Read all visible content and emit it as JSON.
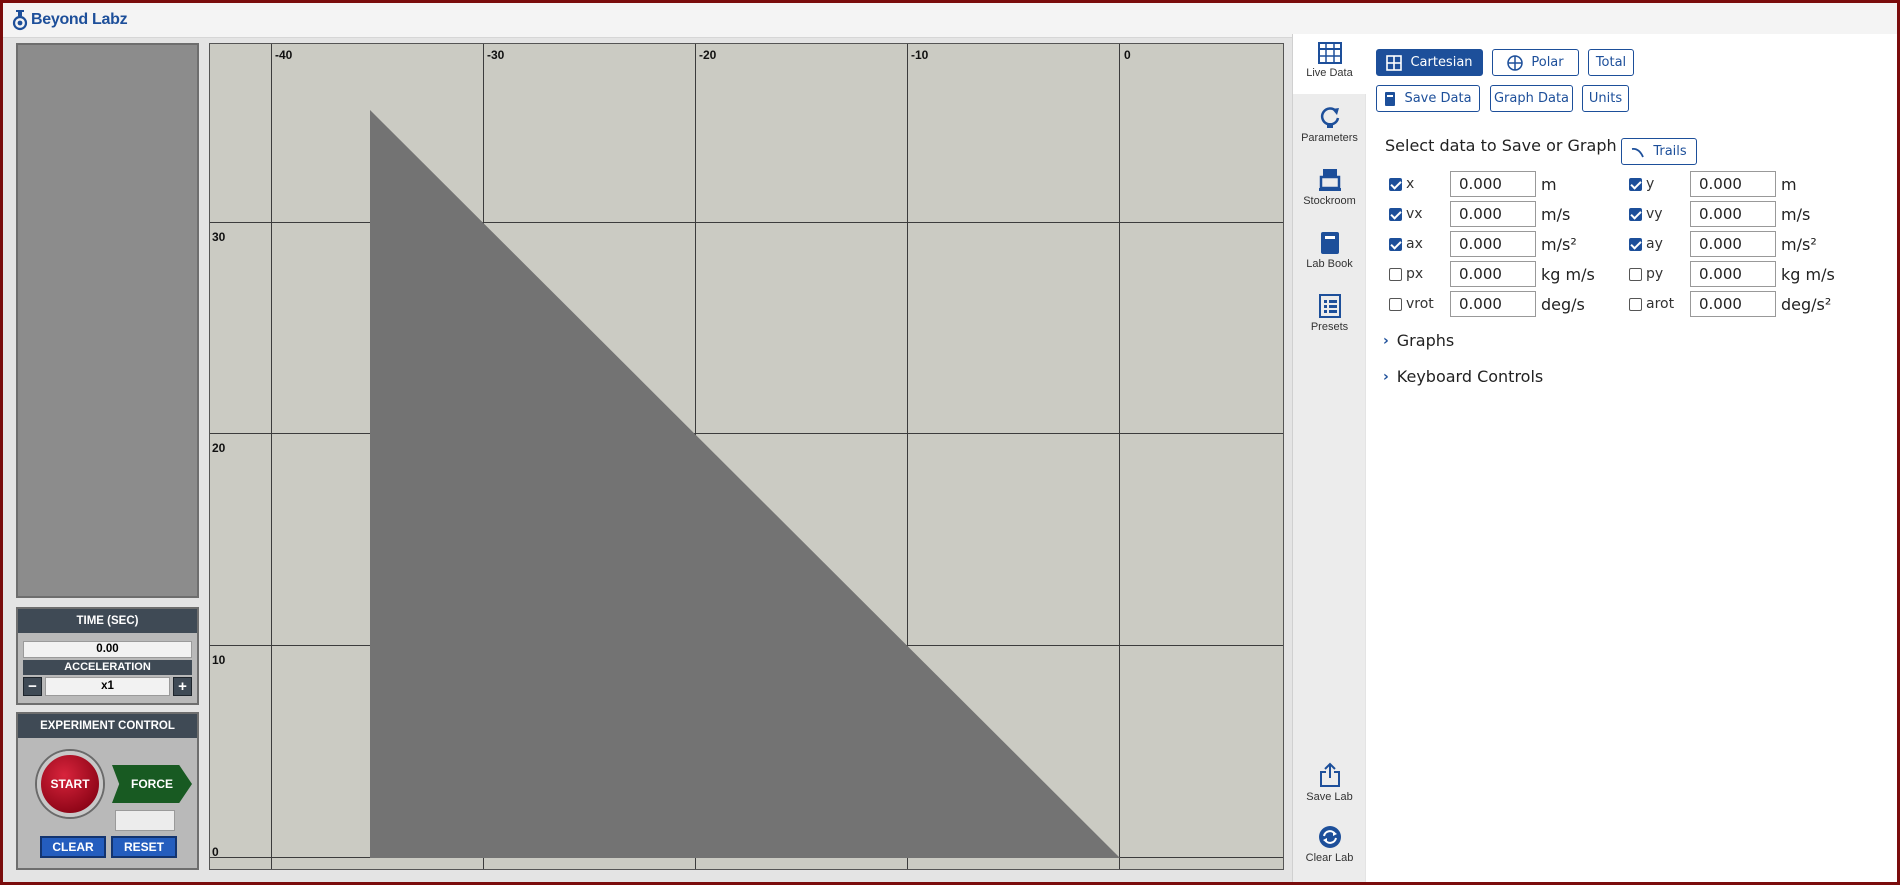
{
  "app": {
    "name": "Beyond Labz",
    "brand_color": "#1d4f9a"
  },
  "left": {
    "time_title": "TIME (SEC)",
    "time_value": "0.00",
    "accel_title": "ACCELERATION",
    "accel_value": "x1",
    "minus": "−",
    "plus": "+",
    "exp_title": "EXPERIMENT CONTROL",
    "start": "START",
    "force": "FORCE",
    "clear": "CLEAR",
    "reset": "RESET"
  },
  "graph": {
    "x_labels": [
      "-40",
      "-30",
      "-20",
      "-10",
      "0"
    ],
    "y_labels": [
      "30",
      "20",
      "10",
      "0"
    ],
    "shape_color": "#737373"
  },
  "tabs": [
    {
      "label": "Live Data",
      "icon": "table-icon"
    },
    {
      "label": "Parameters",
      "icon": "parameters-icon"
    },
    {
      "label": "Stockroom",
      "icon": "stockroom-icon"
    },
    {
      "label": "Lab Book",
      "icon": "lab-book-icon"
    },
    {
      "label": "Presets",
      "icon": "presets-icon"
    },
    {
      "label": "Save Lab",
      "icon": "share-icon"
    },
    {
      "label": "Clear Lab",
      "icon": "refresh-icon"
    }
  ],
  "panel": {
    "modes": {
      "cartesian": "Cartesian",
      "polar": "Polar",
      "total": "Total"
    },
    "actions": {
      "save_data": "Save Data",
      "graph_data": "Graph Data",
      "units": "Units"
    },
    "select_label": "Select data to Save or Graph",
    "trails": "Trails",
    "rows": [
      {
        "label": "x",
        "value": "0.000",
        "unit": "m",
        "checked": true,
        "label2": "y",
        "value2": "0.000",
        "unit2": "m",
        "checked2": true
      },
      {
        "label": "vx",
        "value": "0.000",
        "unit": "m/s",
        "checked": true,
        "label2": "vy",
        "value2": "0.000",
        "unit2": "m/s",
        "checked2": true
      },
      {
        "label": "ax",
        "value": "0.000",
        "unit": "m/s²",
        "checked": true,
        "label2": "ay",
        "value2": "0.000",
        "unit2": "m/s²",
        "checked2": true
      },
      {
        "label": "px",
        "value": "0.000",
        "unit": "kg m/s",
        "checked": false,
        "label2": "py",
        "value2": "0.000",
        "unit2": "kg m/s",
        "checked2": false
      },
      {
        "label": "vrot",
        "value": "0.000",
        "unit": "deg/s",
        "checked": false,
        "label2": "arot",
        "value2": "0.000",
        "unit2": "deg/s²",
        "checked2": false
      }
    ],
    "graphs": "Graphs",
    "keyboard": "Keyboard Controls"
  }
}
